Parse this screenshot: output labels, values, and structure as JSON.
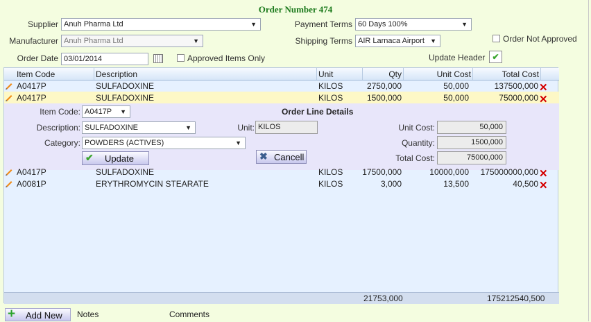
{
  "title": "Order Number 474",
  "header": {
    "supplier_label": "Supplier",
    "supplier_value": "Anuh Pharma Ltd",
    "manufacturer_label": "Manufacturer",
    "manufacturer_value": "Anuh Pharma Ltd",
    "order_date_label": "Order Date",
    "order_date_value": "03/01/2014",
    "approved_only_label": "Approved Items Only",
    "payment_terms_label": "Payment Terms",
    "payment_terms_value": "60 Days 100%",
    "shipping_terms_label": "Shipping Terms",
    "shipping_terms_value": "AIR Larnaca Airport",
    "not_approved_label": "Order Not Approved",
    "update_header_label": "Update Header"
  },
  "grid": {
    "columns": {
      "item_code": "Item Code",
      "description": "Description",
      "unit": "Unit",
      "qty": "Qty",
      "unit_cost": "Unit Cost",
      "total_cost": "Total Cost"
    },
    "rows_top": [
      {
        "item_code": "A0417P",
        "description": "SULFADOXINE",
        "unit": "KILOS",
        "qty": "2750,000",
        "unit_cost": "50,000",
        "total_cost": "137500,000"
      },
      {
        "item_code": "A0417P",
        "description": "SULFADOXINE",
        "unit": "KILOS",
        "qty": "1500,000",
        "unit_cost": "50,000",
        "total_cost": "75000,000"
      }
    ],
    "rows_bottom": [
      {
        "item_code": "A0417P",
        "description": "SULFADOXINE",
        "unit": "KILOS",
        "qty": "17500,000",
        "unit_cost": "10000,000",
        "total_cost": "175000000,000"
      },
      {
        "item_code": "A0081P",
        "description": "ERYTHROMYCIN STEARATE",
        "unit": "KILOS",
        "qty": "3,000",
        "unit_cost": "13,500",
        "total_cost": "40,500"
      }
    ],
    "footer": {
      "qty_total": "21753,000",
      "cost_total": "175212540,500"
    }
  },
  "detail": {
    "heading": "Order Line Details",
    "item_code_label": "Item Code:",
    "item_code_value": "A0417P",
    "description_label": "Description:",
    "description_value": "SULFADOXINE",
    "category_label": "Category:",
    "category_value": "POWDERS (ACTIVES)",
    "unit_label": "Unit:",
    "unit_value": "KILOS",
    "unit_cost_label": "Unit Cost:",
    "unit_cost_value": "50,000",
    "quantity_label": "Quantity:",
    "quantity_value": "1500,000",
    "total_cost_label": "Total Cost:",
    "total_cost_value": "75000,000",
    "update_label": "Update",
    "cancel_label": "Cancell"
  },
  "bottom": {
    "add_new_label": "Add New",
    "notes_label": "Notes",
    "comments_label": "Comments"
  }
}
